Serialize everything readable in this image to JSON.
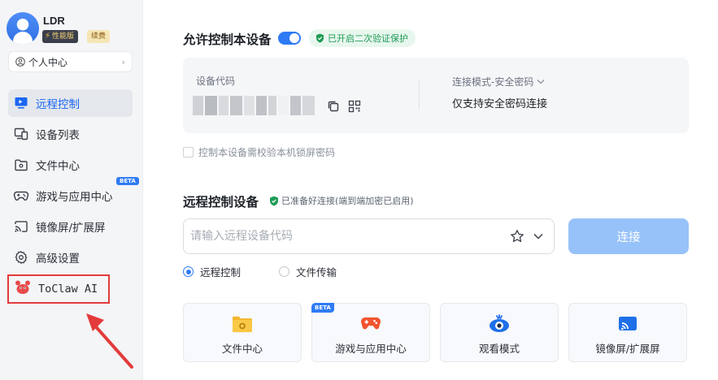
{
  "user": {
    "name": "LDR",
    "badge_performance": "性能版",
    "badge_renew": "续费"
  },
  "personal_center": {
    "label": "个人中心"
  },
  "nav": {
    "items": [
      {
        "label": "远程控制",
        "icon": "monitor-icon",
        "active": true
      },
      {
        "label": "设备列表",
        "icon": "device-list-icon"
      },
      {
        "label": "文件中心",
        "icon": "folder-icon"
      },
      {
        "label": "游戏与应用中心",
        "icon": "gamepad-icon",
        "badge": "BETA"
      },
      {
        "label": "镜像屏/扩展屏",
        "icon": "cast-icon"
      },
      {
        "label": "高级设置",
        "icon": "gear-icon"
      }
    ],
    "toclaw_label": "ToClaw AI"
  },
  "allow_control": {
    "title": "允许控制本设备",
    "toggle_on": true,
    "two_factor_text": "已开启二次验证保护"
  },
  "device_card": {
    "code_label": "设备代码",
    "mode_label": "连接模式-安全密码",
    "mode_value": "仅支持安全密码连接"
  },
  "lock_check": {
    "label": "控制本设备需校验本机锁屏密码",
    "checked": false
  },
  "remote": {
    "title": "远程控制设备",
    "ready_text": "已准备好连接(端到端加密已启用)",
    "input_placeholder": "请输入远程设备代码",
    "input_value": "",
    "connect_label": "连接",
    "radio_remote": "远程控制",
    "radio_file": "文件传输"
  },
  "tiles": [
    {
      "label": "文件中心",
      "icon": "folder-icon"
    },
    {
      "label": "游戏与应用中心",
      "icon": "gamepad-icon",
      "badge": "BETA"
    },
    {
      "label": "观看模式",
      "icon": "eye-icon"
    },
    {
      "label": "镜像屏/扩展屏",
      "icon": "cast-icon"
    }
  ],
  "colors": {
    "accent": "#2f7bf5",
    "success": "#1e9b55",
    "highlight_border": "#e33b3b",
    "connect_disabled": "#97c2f9"
  }
}
